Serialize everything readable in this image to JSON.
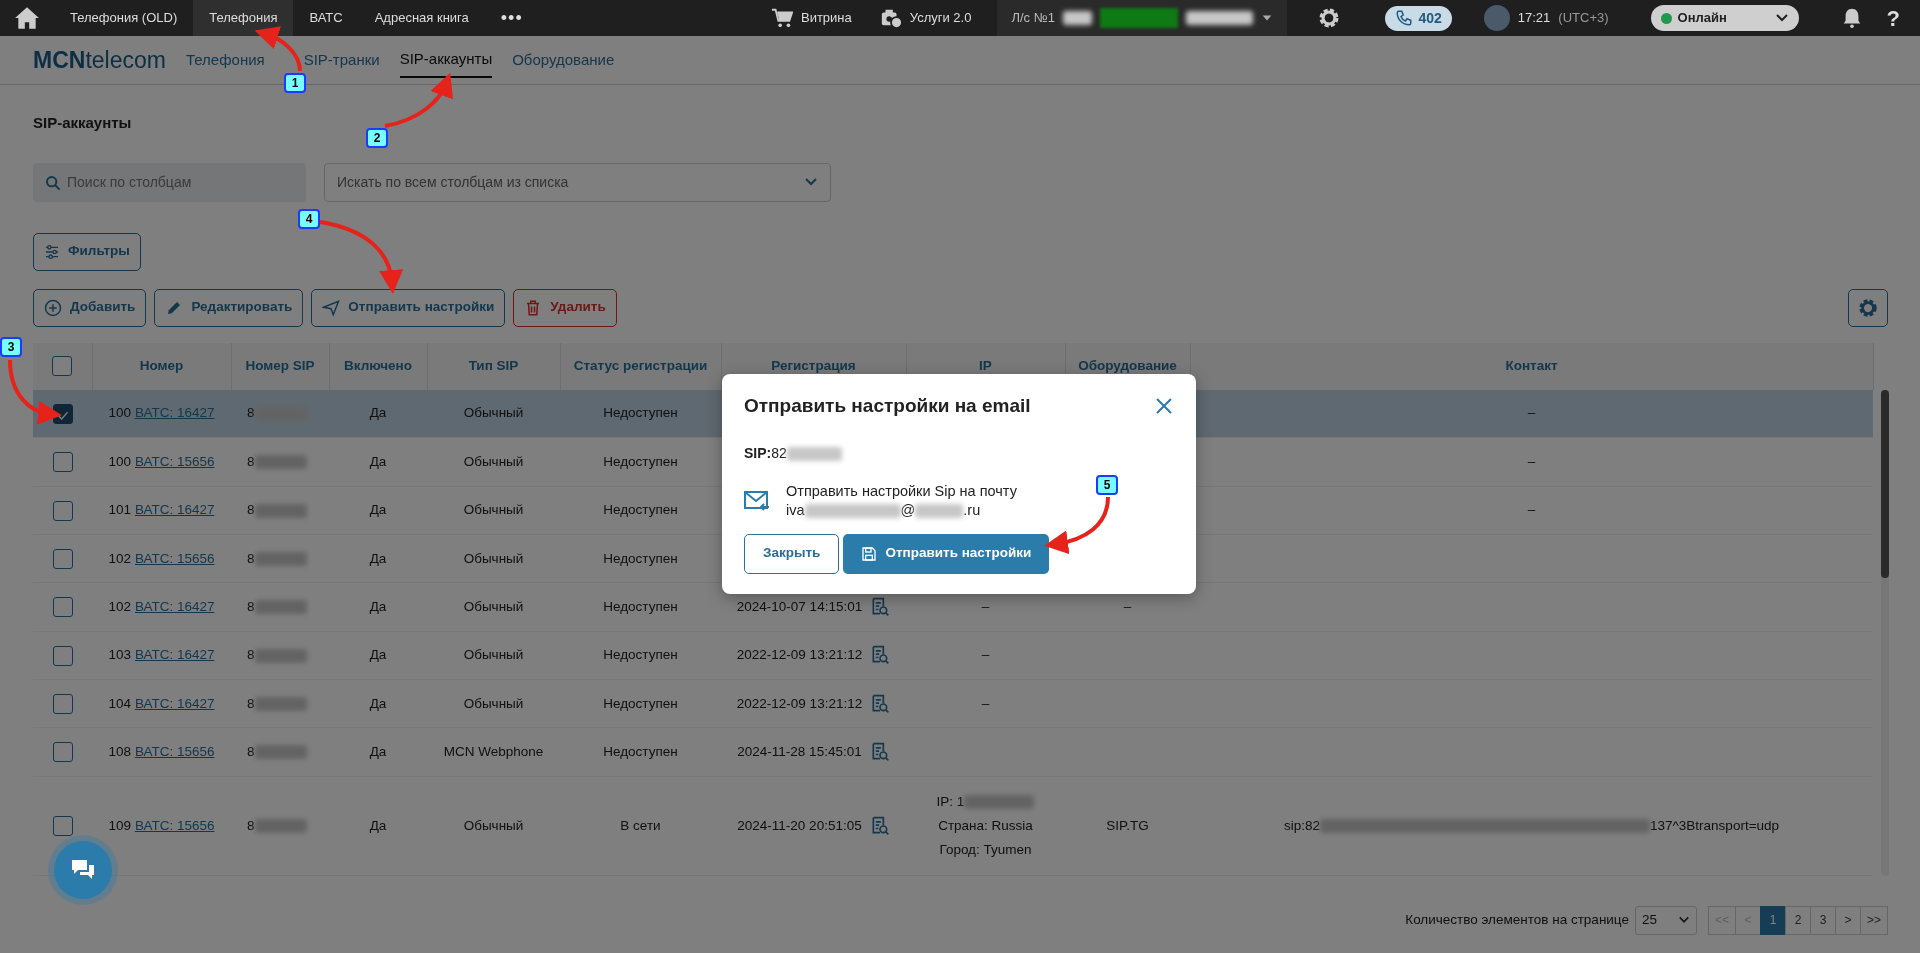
{
  "topbar": {
    "tabs": [
      {
        "label": "Телефония (OLD)",
        "selected": false
      },
      {
        "label": "Телефония",
        "selected": true
      },
      {
        "label": "ВАТС",
        "selected": false
      },
      {
        "label": "Адресная книга",
        "selected": false
      }
    ],
    "more": "•••",
    "links": [
      {
        "kind": "cart",
        "label": "Витрина"
      },
      {
        "kind": "services",
        "label": "Услуги 2.0"
      }
    ],
    "account": "Л/с №1",
    "calls": "402",
    "time": "17:21",
    "timezone": "(UTC+3)",
    "status": {
      "label": "Онлайн",
      "color": "#1f9a4b"
    },
    "help": "?"
  },
  "subnav": {
    "logo": "**MCN**telecom",
    "tabs": [
      {
        "label": "Телефония",
        "selected": false
      },
      {
        "label": "SIP-транки",
        "selected": false
      },
      {
        "label": "SIP-аккаунты",
        "selected": true
      },
      {
        "label": "Оборудование",
        "selected": false
      }
    ]
  },
  "page_title": "SIP-аккаунты",
  "search": {
    "placeholder": "Поиск по столбцам"
  },
  "column_select": {
    "value": "Искать по всем столбцам из списка"
  },
  "filters_button": "Фильтры",
  "actions": [
    {
      "kind": "add",
      "label": "Добавить"
    },
    {
      "kind": "edit",
      "label": "Редактировать"
    },
    {
      "kind": "send",
      "label": "Отправить настройки"
    },
    {
      "kind": "delete",
      "label": "Удалить"
    }
  ],
  "table": {
    "all_checked": false,
    "columns": [
      "Номер",
      "Номер SIP",
      "Включено",
      "Тип SIP",
      "Статус регистрации",
      "Регистрация",
      "IP",
      "Оборудование",
      "Контакт"
    ],
    "rows": [
      {
        "checked": true,
        "selected": true,
        "number": "100",
        "vats": "ВАТС: 16427",
        "sip": "8",
        "enabled": "Да",
        "type": "Обычный",
        "status": "Недоступен",
        "contact": [
          "–"
        ]
      },
      {
        "checked": false,
        "selected": false,
        "number": "100",
        "vats": "ВАТС: 15656",
        "sip": "8",
        "enabled": "Да",
        "type": "Обычный",
        "status": "Недоступен",
        "contact": [
          "–"
        ]
      },
      {
        "checked": false,
        "selected": false,
        "number": "101",
        "vats": "ВАТС: 16427",
        "sip": "8",
        "enabled": "Да",
        "type": "Обычный",
        "status": "Недоступен",
        "contact": [
          "–"
        ]
      },
      {
        "checked": false,
        "selected": false,
        "number": "102",
        "vats": "ВАТС: 15656",
        "sip": "8",
        "enabled": "Да",
        "type": "Обычный",
        "status": "Недоступен"
      },
      {
        "checked": false,
        "selected": false,
        "number": "102",
        "vats": "ВАТС: 16427",
        "sip": "8",
        "enabled": "Да",
        "type": "Обычный",
        "status": "Недоступен",
        "registration": "2024-10-07 14:15:01",
        "ip": [
          "–"
        ],
        "equipment": "–"
      },
      {
        "checked": false,
        "selected": false,
        "number": "103",
        "vats": "ВАТС: 16427",
        "sip": "8",
        "enabled": "Да",
        "type": "Обычный",
        "status": "Недоступен",
        "registration": "2022-12-09 13:21:12",
        "ip": [
          "–"
        ]
      },
      {
        "checked": false,
        "selected": false,
        "number": "104",
        "vats": "ВАТС: 16427",
        "sip": "8",
        "enabled": "Да",
        "type": "Обычный",
        "status": "Недоступен",
        "registration": "2022-12-09 13:21:12",
        "ip": [
          "–"
        ]
      },
      {
        "checked": false,
        "selected": false,
        "number": "108",
        "vats": "ВАТС: 15656",
        "sip": "8",
        "enabled": "Да",
        "type": "MCN Webphone",
        "status": "Недоступен",
        "registration": "2024-11-28 15:45:01"
      },
      {
        "checked": false,
        "selected": false,
        "number": "109",
        "vats": "ВАТС: 15656",
        "sip": "8",
        "enabled": "Да",
        "type": "Обычный",
        "status": "В сети",
        "registration": "2024-11-20 20:51:05",
        "ip": [
          "IP: 1",
          "Страна: Russia",
          "Город: Tyumen"
        ],
        "equipment": "SIP.TG",
        "contact": [
          "sip:82",
          "137^3Btransport=udp"
        ]
      }
    ]
  },
  "pagination": {
    "label": "Количество элементов на странице",
    "page_size": "25",
    "buttons": [
      {
        "label": "<<",
        "disabled": true,
        "selected": false
      },
      {
        "label": "<",
        "disabled": true,
        "selected": false
      },
      {
        "label": "1",
        "disabled": false,
        "selected": true
      },
      {
        "label": "2",
        "disabled": false,
        "selected": false
      },
      {
        "label": "3",
        "disabled": false,
        "selected": false
      },
      {
        "label": ">",
        "disabled": false,
        "selected": false
      },
      {
        "label": ">>",
        "disabled": false,
        "selected": false
      }
    ]
  },
  "modal": {
    "title": "Отправить настройки на email",
    "sip_label": "SIP:",
    "sip_value": "82",
    "text": "Отправить настройки Sip на почту",
    "email_parts": [
      "iva",
      "@",
      ".ru"
    ],
    "close_button": "Закрыть",
    "send_button": "Отправить настройки"
  },
  "callouts": [
    {
      "label": "1"
    },
    {
      "label": "2"
    },
    {
      "label": "3"
    },
    {
      "label": "4"
    },
    {
      "label": "5"
    }
  ]
}
